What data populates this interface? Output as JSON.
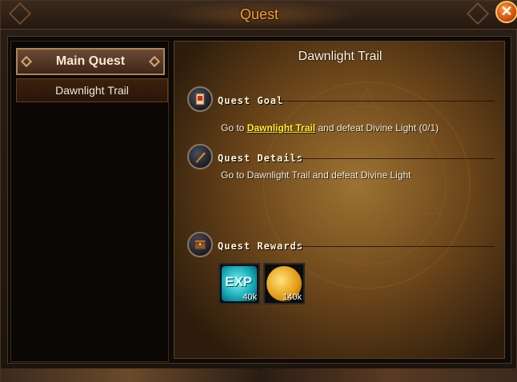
{
  "window": {
    "title": "Quest"
  },
  "close_button": {
    "glyph": "✕"
  },
  "sidebar": {
    "category_label": "Main Quest",
    "quests": [
      "Dawnlight Trail"
    ]
  },
  "detail": {
    "title": "Dawnlight Trail",
    "goal": {
      "heading": "Quest Goal",
      "prefix": "Go to ",
      "link": "Dawnlight Trail",
      "suffix": " and defeat Divine Light (0/1)"
    },
    "details": {
      "heading": "Quest Details",
      "text": "Go to Dawnlight Trail and defeat Divine Light"
    },
    "rewards": {
      "heading": "Quest Rewards",
      "items": [
        {
          "icon": "exp-icon",
          "label": "EXP",
          "qty": "40k",
          "color": "#1fc2c9"
        },
        {
          "icon": "gold-coin-icon",
          "label": "",
          "qty": "140k",
          "color": "#f2b21c"
        }
      ]
    }
  },
  "colors": {
    "title": "#f1a23a",
    "link": "#ffee2a",
    "panel_border": "#b08454"
  }
}
